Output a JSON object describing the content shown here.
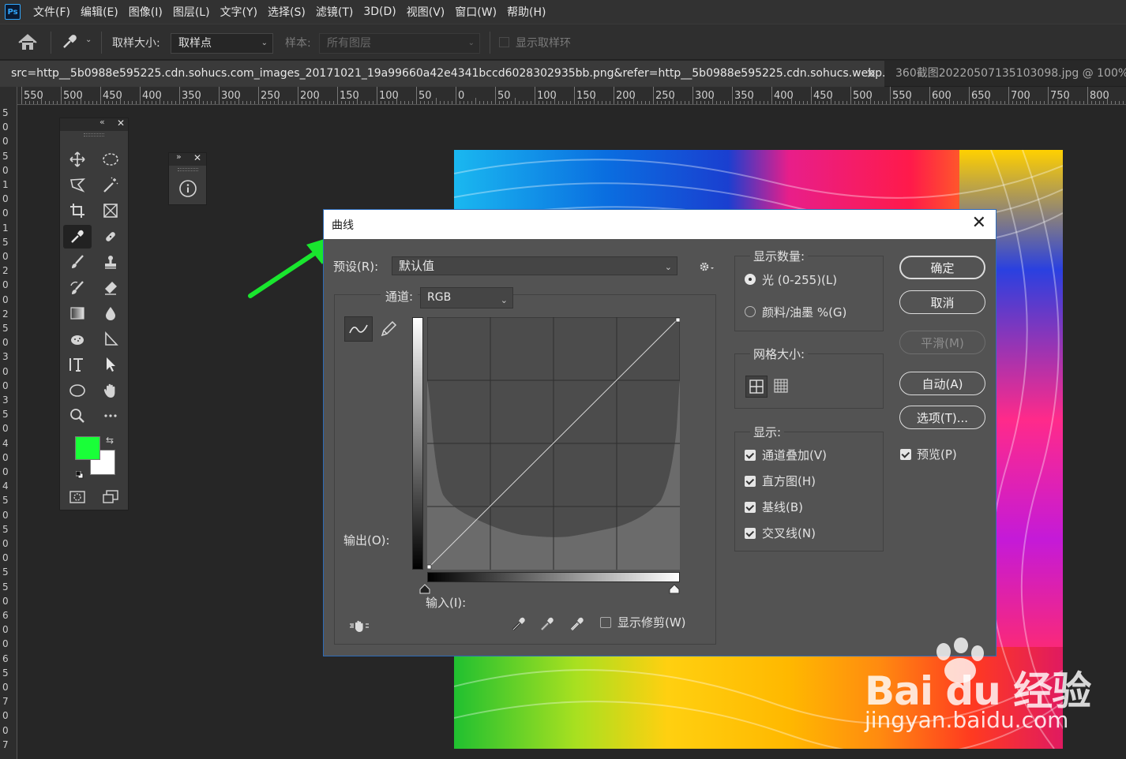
{
  "app": {
    "logo_text": "Ps",
    "menu": [
      "文件(F)",
      "编辑(E)",
      "图像(I)",
      "图层(L)",
      "文字(Y)",
      "选择(S)",
      "滤镜(T)",
      "3D(D)",
      "视图(V)",
      "窗口(W)",
      "帮助(H)"
    ]
  },
  "options_bar": {
    "sample_size_label": "取样大小:",
    "sample_size_value": "取样点",
    "sample_label": "样本:",
    "sample_value": "所有图层",
    "show_ring_label": "显示取样环"
  },
  "tabs": [
    {
      "title": "src=http__5b0988e595225.cdn.sohucs.com_images_20171021_19a99660a42e4341bccd6028302935bb.png&refer=http__5b0988e595225.cdn.sohucs.webp.jpg",
      "active": true
    },
    {
      "title": "360截图20220507135103098.jpg @ 100%(R",
      "active": false
    }
  ],
  "ruler": {
    "h_labels": [
      "550",
      "500",
      "450",
      "400",
      "350",
      "300",
      "250",
      "200",
      "150",
      "100",
      "50",
      "0",
      "50",
      "100",
      "150",
      "200",
      "250",
      "300",
      "350",
      "400",
      "450",
      "500",
      "550",
      "600",
      "650",
      "700",
      "750",
      "800"
    ],
    "v_labels": [
      "5",
      "0",
      "0",
      "5",
      "0",
      "1",
      "0",
      "0",
      "1",
      "5",
      "0",
      "2",
      "0",
      "0",
      "2",
      "5",
      "0",
      "3",
      "0",
      "0",
      "3",
      "5",
      "0",
      "4",
      "0",
      "0",
      "4",
      "5",
      "0",
      "5",
      "0",
      "0",
      "5",
      "5",
      "0",
      "6",
      "0",
      "0",
      "6",
      "5",
      "0",
      "7",
      "0",
      "0",
      "7"
    ]
  },
  "colors": {
    "foreground": "#19ff38",
    "background": "#ffffff",
    "arrow": "#19e62e",
    "dialog_border": "#2d6bb8"
  },
  "curves_dialog": {
    "title": "曲线",
    "close_symbol": "✕",
    "preset_label": "预设(R):",
    "preset_value": "默认值",
    "channel_label": "通道:",
    "channel_value": "RGB",
    "output_label": "输出(O):",
    "input_label": "输入(I):",
    "show_clipping_label": "显示修剪(W)",
    "show_clipping_checked": false,
    "show_amount_title": "显示数量:",
    "light_label": "光 (0-255)(L)",
    "pigment_label": "颜料/油墨 %(G)",
    "light_selected": true,
    "grid_size_title": "网格大小:",
    "display_title": "显示:",
    "display_options": [
      {
        "label": "通道叠加(V)",
        "checked": true
      },
      {
        "label": "直方图(H)",
        "checked": true
      },
      {
        "label": "基线(B)",
        "checked": true
      },
      {
        "label": "交叉线(N)",
        "checked": true
      }
    ],
    "buttons": {
      "ok": "确定",
      "cancel": "取消",
      "smooth": "平滑(M)",
      "auto": "自动(A)",
      "options": "选项(T)..."
    },
    "preview_label": "预览(P)",
    "preview_checked": true
  },
  "watermark": {
    "brand": "Bai du 经验",
    "url": "jingyan.baidu.com"
  }
}
